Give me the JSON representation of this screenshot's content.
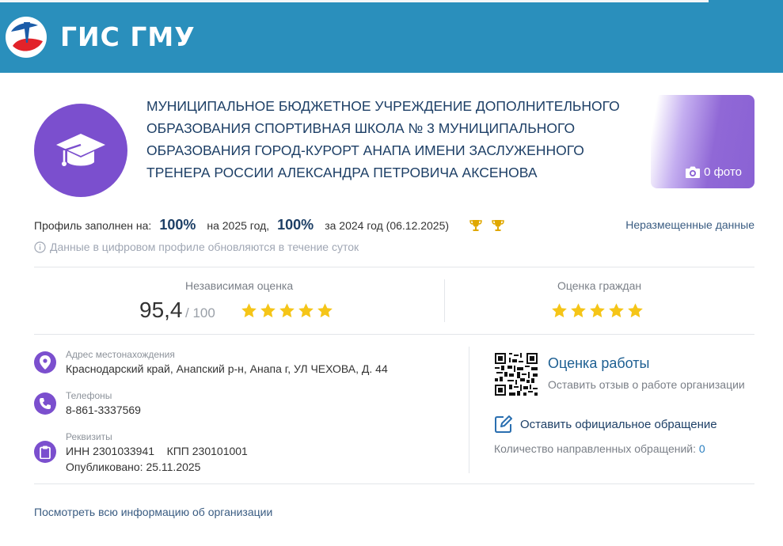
{
  "header": {
    "logo_text": "ГИС ГМУ"
  },
  "org": {
    "title": "МУНИЦИПАЛЬНОЕ БЮДЖЕТНОЕ УЧРЕЖДЕНИЕ ДОПОЛНИТЕЛЬНОГО ОБРАЗОВАНИЯ СПОРТИВНАЯ ШКОЛА № 3 МУНИЦИПАЛЬНОГО ОБРАЗОВАНИЯ ГОРОД-КУРОРТ АНАПА ИМЕНИ ЗАСЛУЖЕННОГО ТРЕНЕРА РОССИИ АЛЕКСАНДРА ПЕТРОВИЧА АКСЕНОВА",
    "avatar_icon": "graduation-cap-icon",
    "photo_label": "0 фото"
  },
  "profile": {
    "filled_label": "Профиль заполнен на:",
    "pct_2025": "100%",
    "year_2025_label": "на 2025 год,",
    "pct_2024": "100%",
    "year_2024_label": "за 2024 год (06.12.2025)",
    "unplaced_link": "Неразмещенные данные",
    "info_note": "Данные в цифровом профиле обновляются в течение суток"
  },
  "ratings": {
    "independent_label": "Независимая оценка",
    "independent_value": "95,4",
    "independent_max": "/ 100",
    "independent_stars": 5,
    "citizens_label": "Оценка граждан",
    "citizens_stars": 5
  },
  "contacts": {
    "address_label": "Адрес местонахождения",
    "address_value": "Краснодарский край, Анапский р-н, Анапа г, УЛ ЧЕХОВА, Д. 44",
    "phones_label": "Телефоны",
    "phones_value": "8-861-3337569",
    "requisites_label": "Реквизиты",
    "requisites_value": "ИНН 2301033941    КПП 230101001",
    "published_value": "Опубликовано: 25.11.2025"
  },
  "actions": {
    "rate_title": "Оценка работы",
    "rate_subtitle": "Оставить отзыв о работе организации",
    "appeal_link": "Оставить официальное обращение",
    "appeal_count_label": "Количество направленных обращений:",
    "appeal_count_value": "0",
    "view_all_link": "Посмотреть всю информацию об организации"
  },
  "colors": {
    "header_bg": "#2a8fbc",
    "accent_purple": "#7b4fce",
    "title_blue": "#1d3f66",
    "star_yellow": "#f5c518"
  }
}
